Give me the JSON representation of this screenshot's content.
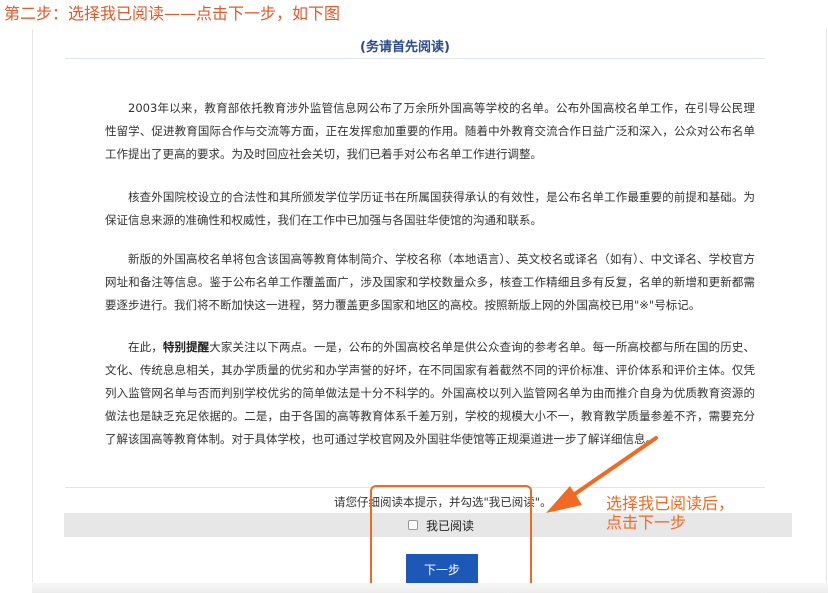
{
  "step_caption": "第二步：选择我已阅读——点击下一步，如下图",
  "notice": {
    "title": "(务请首先阅读)",
    "paragraphs": [
      "2003年以来，教育部依托教育涉外监管信息网公布了万余所外国高等学校的名单。公布外国高校名单工作，在引导公民理性留学、促进教育国际合作与交流等方面，正在发挥愈加重要的作用。随着中外教育交流合作日益广泛和深入，公众对公布名单工作提出了更高的要求。为及时回应社会关切，我们已着手对公布名单工作进行调整。",
      "核查外国院校设立的合法性和其所颁发学位学历证书在所属国获得承认的有效性，是公布名单工作最重要的前提和基础。为保证信息来源的准确性和权威性，我们在工作中已加强与各国驻华使馆的沟通和联系。",
      "新版的外国高校名单将包含该国高等教育体制简介、学校名称（本地语言）、英文校名或译名（如有）、中文译名、学校官方网址和备注等信息。鉴于公布名单工作覆盖面广，涉及国家和学校数量众多，核查工作精细且多有反复，名单的新增和更新都需要逐步进行。我们将不断加快这一进程，努力覆盖更多国家和地区的高校。按照新版上网的外国高校已用\"※\"号标记。"
    ],
    "p4_lead": "在此，",
    "p4_emphasis": "特别提醒",
    "p4_rest": "大家关注以下两点。一是，公布的外国高校名单是供公众查询的参考名单。每一所高校都与所在国的历史、文化、传统息息相关，其办学质量的优劣和办学声誉的好坏，在不同国家有着截然不同的评价标准、评价体系和评价主体。仅凭列入监管网名单与否而判别学校优劣的简单做法是十分不科学的。外国高校以列入监管网名单为由而推介自身为优质教育资源的做法也是缺乏充足依据的。二是，由于各国的高等教育体系千差万别，学校的规模大小不一，教育教学质量参差不齐，需要充分了解该国高等教育体制。对于具体学校，也可通过学校官网及外国驻华使馆等正规渠道进一步了解详细信息。",
    "prompt": "请您仔细阅读本提示，并勾选\"我已阅读\"。"
  },
  "agree": {
    "checkbox_label": "我已阅读",
    "checked": false
  },
  "next_button_label": "下一步",
  "annotation": {
    "line1": "选择我已阅读后，",
    "line2": "点击下一步",
    "color": "#f26a22"
  },
  "colors": {
    "caption": "#e05a2b",
    "title": "#2a4b8d",
    "button": "#1d57b8"
  }
}
